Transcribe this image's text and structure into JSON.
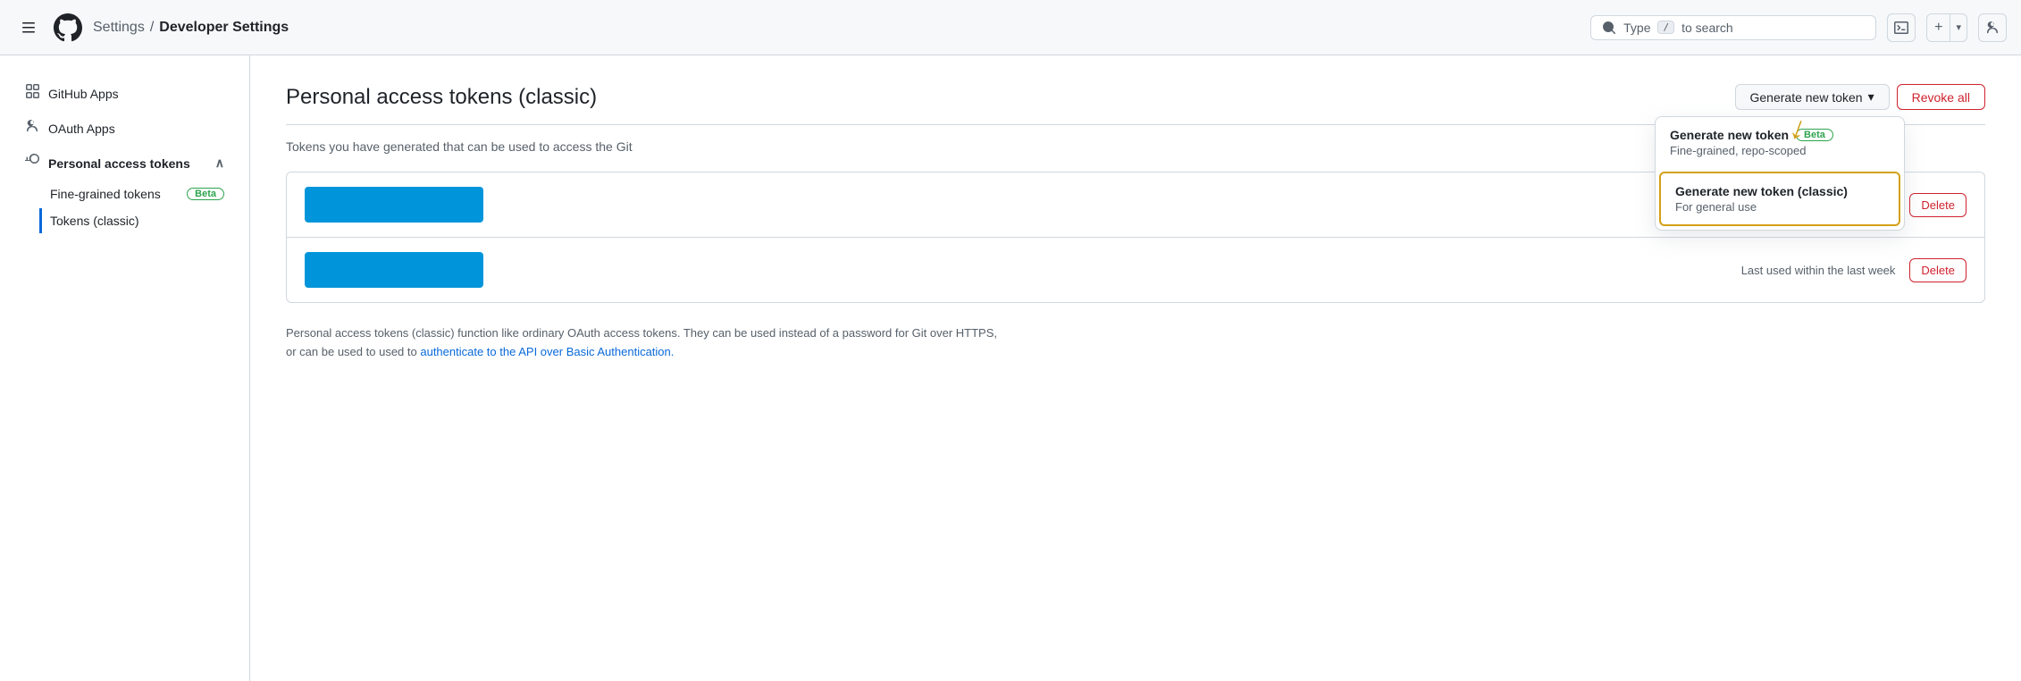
{
  "topnav": {
    "settings_label": "Settings",
    "separator": "/",
    "current_label": "Developer Settings",
    "search_placeholder": "Type",
    "search_kbd": "/",
    "search_suffix": "to search"
  },
  "sidebar": {
    "github_apps_label": "GitHub Apps",
    "oauth_apps_label": "OAuth Apps",
    "personal_access_tokens_label": "Personal access tokens",
    "fine_grained_label": "Fine-grained tokens",
    "tokens_classic_label": "Tokens (classic)",
    "beta_badge": "Beta"
  },
  "main": {
    "page_title": "Personal access tokens (classic)",
    "generate_btn": "Generate new token",
    "revoke_all_btn": "Revoke all",
    "description": "Tokens you have generated that can be used to access the Git",
    "token_row1_last_used": "",
    "token_row2_last_used": "Last used within the last week",
    "delete_label": "Delete",
    "footer_text": "Personal access tokens (classic) function like ordinary OAuth access tokens. They can be used instead of a password for Git over HTTPS, or can be used to",
    "footer_link": "authenticate to the API over Basic Authentication.",
    "footer_text2": "used to "
  },
  "dropdown": {
    "item1_title": "Generate new token",
    "item1_beta": "Beta",
    "item1_subtitle": "Fine-grained, repo-scoped",
    "item2_title": "Generate new token (classic)",
    "item2_subtitle": "For general use"
  }
}
